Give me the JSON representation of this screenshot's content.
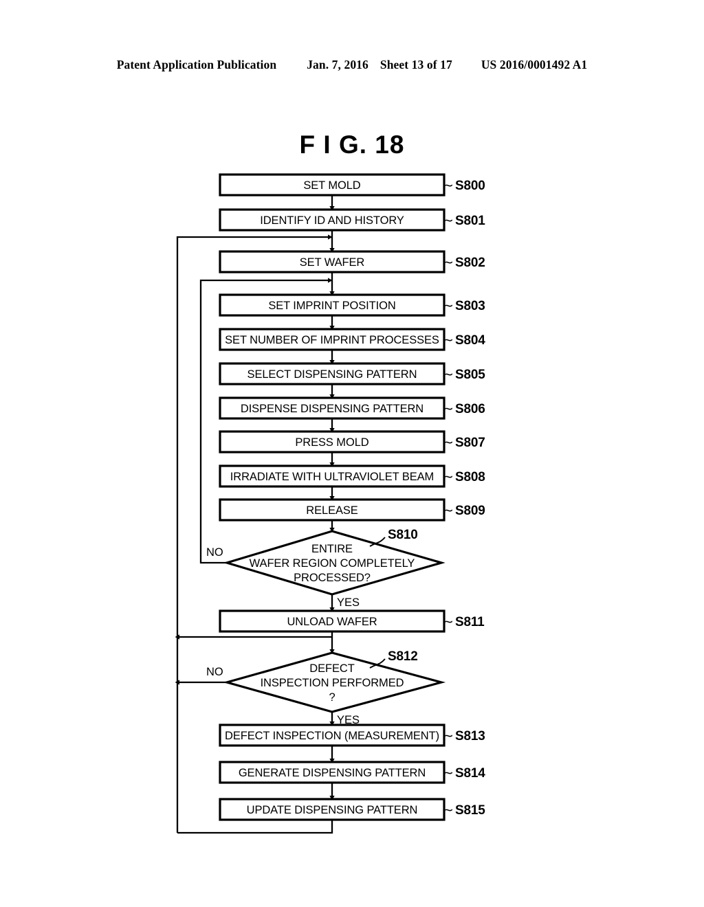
{
  "header": {
    "publication": "Patent Application Publication",
    "date": "Jan. 7, 2016",
    "sheet": "Sheet 13 of 17",
    "number": "US 2016/0001492 A1"
  },
  "figure": {
    "title": "F I G.  18"
  },
  "flowchart": {
    "steps": [
      {
        "ref": "S800",
        "label": "SET MOLD",
        "shape": "process"
      },
      {
        "ref": "S801",
        "label": "IDENTIFY ID AND HISTORY",
        "shape": "process"
      },
      {
        "ref": "S802",
        "label": "SET WAFER",
        "shape": "process"
      },
      {
        "ref": "S803",
        "label": "SET IMPRINT POSITION",
        "shape": "process"
      },
      {
        "ref": "S804",
        "label": "SET NUMBER OF IMPRINT PROCESSES",
        "shape": "process"
      },
      {
        "ref": "S805",
        "label": "SELECT DISPENSING PATTERN",
        "shape": "process"
      },
      {
        "ref": "S806",
        "label": "DISPENSE DISPENSING PATTERN",
        "shape": "process"
      },
      {
        "ref": "S807",
        "label": "PRESS MOLD",
        "shape": "process"
      },
      {
        "ref": "S808",
        "label": "IRRADIATE WITH ULTRAVIOLET BEAM",
        "shape": "process"
      },
      {
        "ref": "S809",
        "label": "RELEASE",
        "shape": "process"
      },
      {
        "ref": "S810",
        "shape": "decision",
        "lines": [
          "ENTIRE",
          "WAFER REGION COMPLETELY",
          "PROCESSED?"
        ],
        "yes_label": "YES",
        "no_label": "NO"
      },
      {
        "ref": "S811",
        "label": "UNLOAD WAFER",
        "shape": "process"
      },
      {
        "ref": "S812",
        "shape": "decision",
        "lines": [
          "DEFECT",
          "INSPECTION PERFORMED",
          "?"
        ],
        "yes_label": "YES",
        "no_label": "NO"
      },
      {
        "ref": "S813",
        "label": "DEFECT INSPECTION (MEASUREMENT)",
        "shape": "process"
      },
      {
        "ref": "S814",
        "label": "GENERATE DISPENSING PATTERN",
        "shape": "process"
      },
      {
        "ref": "S815",
        "label": "UPDATE DISPENSING PATTERN",
        "shape": "process"
      }
    ],
    "ref_tilde": "∼",
    "colors": {
      "line": "#000000",
      "fill": "#ffffff",
      "text": "#000000"
    }
  }
}
